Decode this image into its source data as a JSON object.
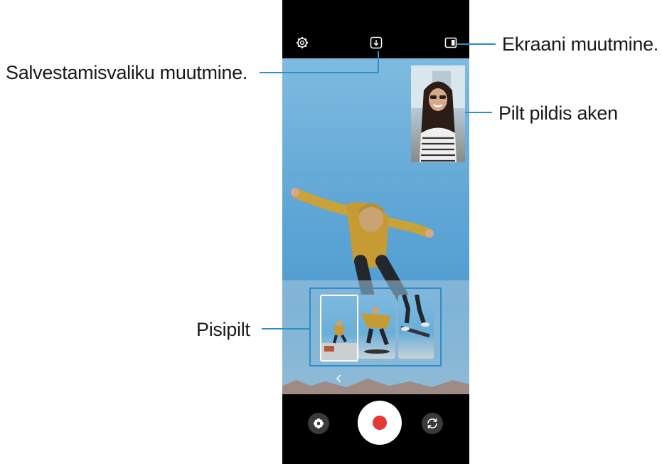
{
  "callouts": {
    "save_option": "Salvestamisvaliku muutmine.",
    "screen_change": "Ekraani muutmine.",
    "pip_window": "Pilt pildis aken",
    "thumbnail": "Pisipilt"
  },
  "icons": {
    "settings": "gear-icon",
    "save_option": "download-icon",
    "screen_layout": "layout-icon",
    "effects": "flower-icon",
    "record": "record-icon",
    "switch_camera": "switch-camera-icon",
    "back_arrow": "chevron-left-icon"
  },
  "colors": {
    "callout_line": "#2a8fca",
    "record_dot": "#e53935",
    "sky": "#5fa6d6"
  }
}
